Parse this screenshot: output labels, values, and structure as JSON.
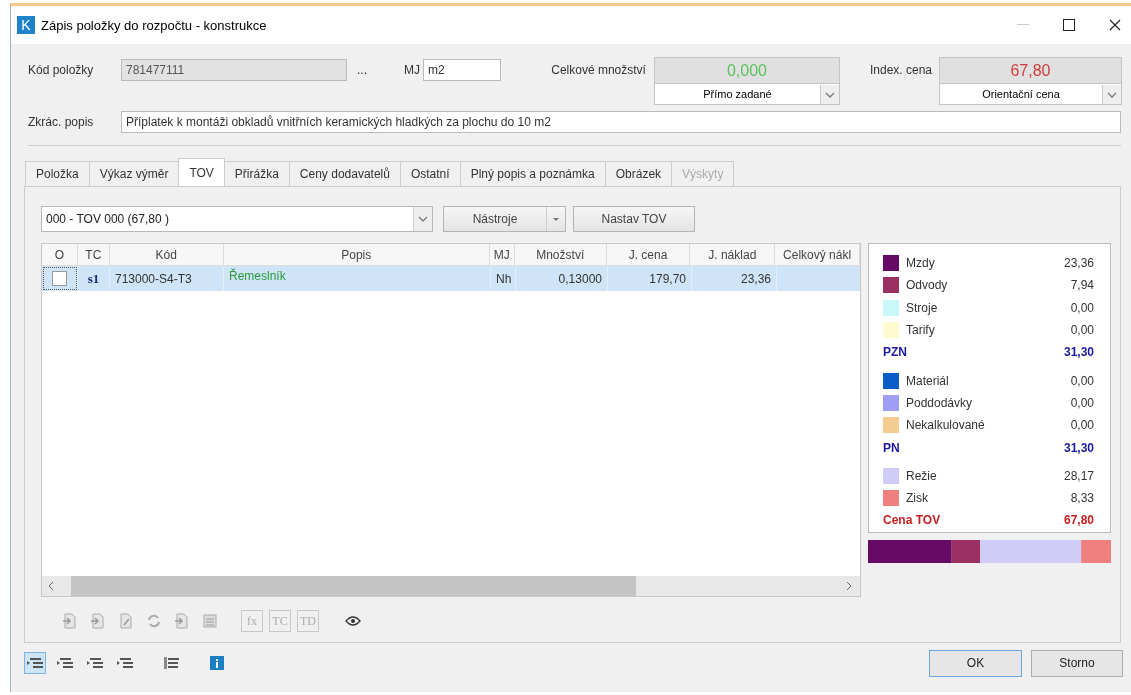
{
  "window": {
    "icon": "K",
    "title": "Zápis položky do rozpočtu - konstrukce"
  },
  "header": {
    "code_label": "Kód položky",
    "code": "781477111",
    "browse": "...",
    "unit_label": "MJ",
    "unit": "m2",
    "quantity_label": "Celkové množství",
    "quantity": "0,000",
    "quantity_source": "Přímo zadané",
    "price_label": "Index. cena",
    "price": "67,80",
    "price_type": "Orientační cena",
    "short_desc_label": "Zkrác. popis",
    "short_desc": "Příplatek k montáži obkladů vnitřních keramických hladkých za plochu do 10 m2"
  },
  "tabs": [
    {
      "label": "Položka",
      "selected": false,
      "disabled": false
    },
    {
      "label": "Výkaz výměr",
      "selected": false,
      "disabled": false
    },
    {
      "label": "TOV",
      "selected": true,
      "disabled": false
    },
    {
      "label": "Přirážka",
      "selected": false,
      "disabled": false
    },
    {
      "label": "Ceny dodavatelů",
      "selected": false,
      "disabled": false
    },
    {
      "label": "Ostatní",
      "selected": false,
      "disabled": false
    },
    {
      "label": "Plný popis a poznámka",
      "selected": false,
      "disabled": false
    },
    {
      "label": "Obrázek",
      "selected": false,
      "disabled": false
    },
    {
      "label": "Výskyty",
      "selected": false,
      "disabled": true
    }
  ],
  "tov": {
    "variant": "000 - TOV 000 (67,80 )",
    "tools_button": "Nástroje",
    "set_button": "Nastav TOV"
  },
  "table": {
    "columns": [
      "O",
      "TC",
      "Kód",
      "Popis",
      "MJ",
      "Množství",
      "J. cena",
      "J. náklad",
      "Celkový nákl"
    ],
    "rows": [
      {
        "selected": true,
        "checked": false,
        "tc": "s1",
        "code": "713000-S4-T3",
        "description": "Řemeslník",
        "unit": "Nh",
        "quantity": "0,13000",
        "unit_price": "179,70",
        "unit_cost": "23,36"
      }
    ]
  },
  "legend": [
    {
      "kind": "item",
      "label": "Mzdy",
      "value": "23,36",
      "color": "#660a66"
    },
    {
      "kind": "item",
      "label": "Odvody",
      "value": "7,94",
      "color": "#9b3062"
    },
    {
      "kind": "item",
      "label": "Stroje",
      "value": "0,00",
      "color": "#c8f8f8"
    },
    {
      "kind": "item",
      "label": "Tarify",
      "value": "0,00",
      "color": "#fffbd0"
    },
    {
      "kind": "subtotal",
      "label": "PZN",
      "value": "31,30"
    },
    {
      "kind": "item",
      "label": "Materiál",
      "value": "0,00",
      "color": "#0a5cc8"
    },
    {
      "kind": "item",
      "label": "Poddodávky",
      "value": "0,00",
      "color": "#9e9ef5"
    },
    {
      "kind": "item",
      "label": "Nekalkulované",
      "value": "0,00",
      "color": "#f5cc90"
    },
    {
      "kind": "subtotal",
      "label": "PN",
      "value": "31,30"
    },
    {
      "kind": "item",
      "label": "Režie",
      "value": "28,17",
      "color": "#cfcdf7"
    },
    {
      "kind": "item",
      "label": "Zisk",
      "value": "8,33",
      "color": "#f08080"
    },
    {
      "kind": "total",
      "label": "Cena TOV",
      "value": "67,80"
    }
  ],
  "toolbar": {
    "text_buttons": [
      "fx",
      "TC",
      "TD"
    ]
  },
  "view_modes": [
    {
      "selected": true
    },
    {
      "selected": false
    },
    {
      "selected": false
    },
    {
      "selected": false
    },
    {
      "selected": false
    }
  ],
  "buttons": [
    "OK",
    "Storno"
  ]
}
